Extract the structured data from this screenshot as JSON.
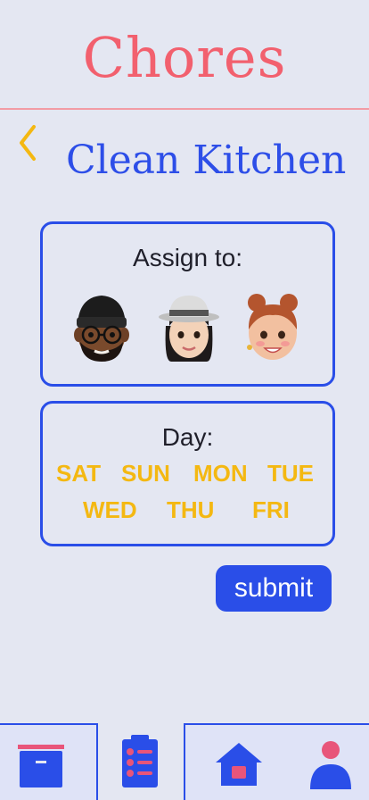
{
  "header": {
    "app_title": "Chores"
  },
  "chore": {
    "title": "Clean Kitchen"
  },
  "assign": {
    "label": "Assign to:",
    "avatars": [
      {
        "icon": "man-beanie-avatar-icon"
      },
      {
        "icon": "woman-hat-avatar-icon"
      },
      {
        "icon": "woman-buns-avatar-icon"
      }
    ]
  },
  "day": {
    "label": "Day:",
    "row1": [
      "SAT",
      "SUN",
      "MON",
      "TUE"
    ],
    "row2": [
      "WED",
      "THU",
      "FRI"
    ]
  },
  "actions": {
    "submit_label": "submit"
  },
  "nav": {
    "tabs": [
      {
        "icon": "archive-box-icon"
      },
      {
        "icon": "chore-list-icon"
      },
      {
        "icon": "home-icon"
      },
      {
        "icon": "profile-icon"
      }
    ]
  },
  "colors": {
    "background": "#e4e7f2",
    "title_pink": "#f2606e",
    "accent_blue": "#2a4ee8",
    "day_yellow": "#f4b812",
    "icon_pink": "#e8557a"
  }
}
